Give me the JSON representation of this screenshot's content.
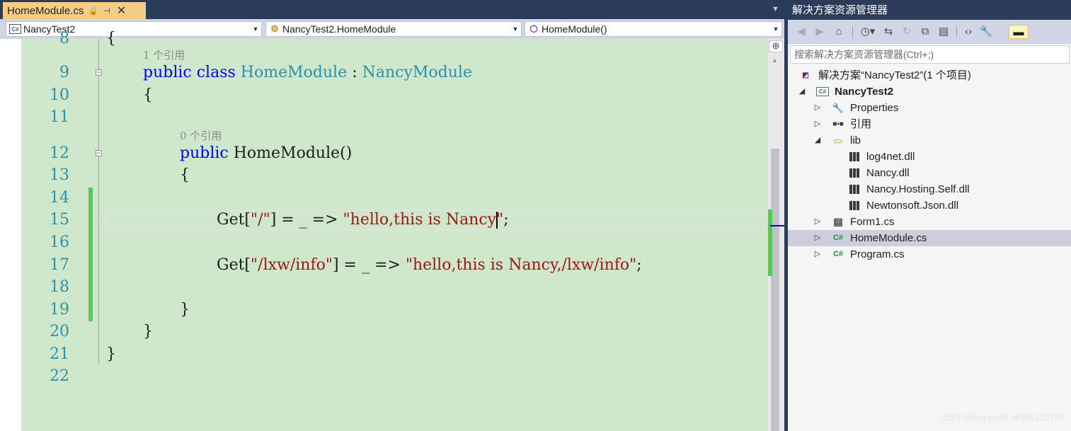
{
  "tab": {
    "title": "HomeModule.cs",
    "pin_icon": "pin-icon",
    "close_glyph": "✕"
  },
  "navbar": {
    "project": "NancyTest2",
    "class": "NancyTest2.HomeModule",
    "member": "HomeModule()"
  },
  "editor": {
    "partial_line_number": "8",
    "partial_line_code": "{",
    "lines": [
      {
        "n": "9",
        "lens": "1 个引用"
      },
      {
        "n": "10"
      },
      {
        "n": "11"
      },
      {
        "n": "12",
        "lens": "0 个引用"
      },
      {
        "n": "13"
      },
      {
        "n": "14"
      },
      {
        "n": "15"
      },
      {
        "n": "16"
      },
      {
        "n": "17"
      },
      {
        "n": "18"
      },
      {
        "n": "19"
      },
      {
        "n": "20"
      },
      {
        "n": "21"
      },
      {
        "n": "22"
      }
    ],
    "tokens": {
      "public": "public",
      "class": "class",
      "class_name": "HomeModule",
      "colon": ":",
      "base_class": "NancyModule",
      "open_brace": "{",
      "close_brace": "}",
      "ctor": "HomeModule()",
      "get1_prefix": "Get[",
      "get1_route": "\"/\"",
      "get1_mid": "] = _ => ",
      "get1_value": "\"hello,this is Nancy\"",
      "semicolon": ";",
      "get2_prefix": "Get[",
      "get2_route": "\"/lxw/info\"",
      "get2_mid": "] = _ => ",
      "get2_value": "\"hello,this is Nancy,/lxw/info\""
    }
  },
  "solution_explorer": {
    "title": "解决方案资源管理器",
    "search_placeholder": "搜索解决方案资源管理器(Ctrl+;)",
    "tree": [
      {
        "label": "解决方案“NancyTest2”(1 个项目)",
        "icon": "solution-icon"
      },
      {
        "label": "NancyTest2",
        "icon": "csharp-project-icon",
        "bold": true
      },
      {
        "label": "Properties",
        "icon": "wrench-icon"
      },
      {
        "label": "引用",
        "icon": "references-icon"
      },
      {
        "label": "lib",
        "icon": "folder-icon"
      },
      {
        "label": "log4net.dll",
        "icon": "dll-icon"
      },
      {
        "label": "Nancy.dll",
        "icon": "dll-icon"
      },
      {
        "label": "Nancy.Hosting.Self.dll",
        "icon": "dll-icon"
      },
      {
        "label": "Newtonsoft.Json.dll",
        "icon": "dll-icon"
      },
      {
        "label": "Form1.cs",
        "icon": "form-icon"
      },
      {
        "label": "HomeModule.cs",
        "icon": "csharp-file-icon",
        "selected": true
      },
      {
        "label": "Program.cs",
        "icon": "csharp-file-icon"
      }
    ]
  },
  "watermark": "https://blog.csdn.net/lw112190"
}
